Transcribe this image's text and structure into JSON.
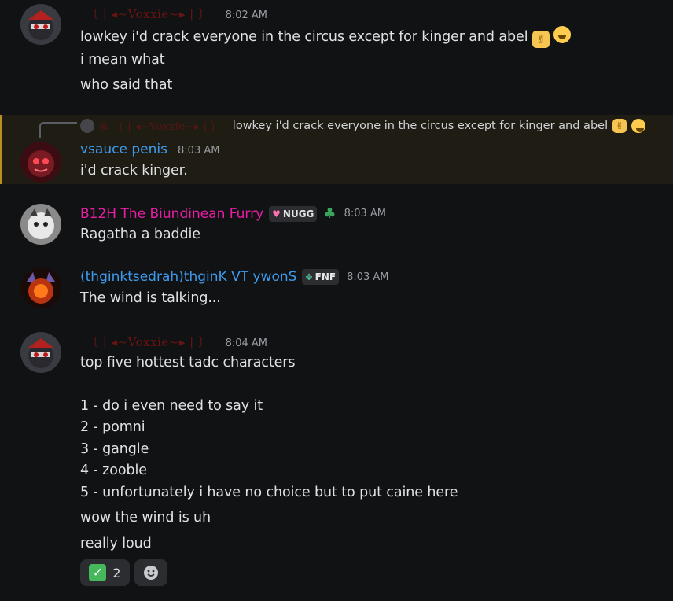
{
  "messages": [
    {
      "author": "〔 | ◂~Voxxie~▸ | 〕",
      "timestamp": "8:02 AM",
      "lines": [
        "lowkey i'd crack everyone in the circus except for kinger and abel",
        "i mean what",
        "who said that"
      ]
    },
    {
      "reply_author": "@ 〔 | ◂~Voxxie~▸ | 〕",
      "reply_text": "lowkey i'd crack everyone in the circus except for kinger and abel",
      "author": "vsauce penis",
      "timestamp": "8:03 AM",
      "lines": [
        "i'd crack kinger."
      ]
    },
    {
      "author": "B12H The Biundinean Furry",
      "badge": "NUGG",
      "timestamp": "8:03 AM",
      "lines": [
        "Ragatha a baddie"
      ]
    },
    {
      "author": "(thginktsedrah)thginK VT ywonS",
      "badge": "FNF",
      "timestamp": "8:03 AM",
      "lines": [
        "The wind is talking..."
      ]
    },
    {
      "author": "〔 | ◂~Voxxie~▸ | 〕",
      "timestamp": "8:04 AM",
      "lines": [
        "top five hottest tadc characters",
        "1 - do i even need to say it",
        "2 - pomni",
        "3 - gangle",
        "4 - zooble",
        "5 - unfortunately i have no choice but to put caine here",
        "wow the wind is uh",
        "really loud"
      ],
      "reactions": [
        {
          "emoji": "check-mark-emoji",
          "count": "2"
        },
        {
          "emoji": "add-reaction-icon",
          "count": ""
        }
      ]
    }
  ],
  "colors": {
    "background": "#111214",
    "mention_highlight": "#1f1c14",
    "mention_bar": "#b98f22",
    "blue_name": "#3d9cf0",
    "pink_name": "#e91ea5",
    "voxxie_name": "#6b1313"
  }
}
